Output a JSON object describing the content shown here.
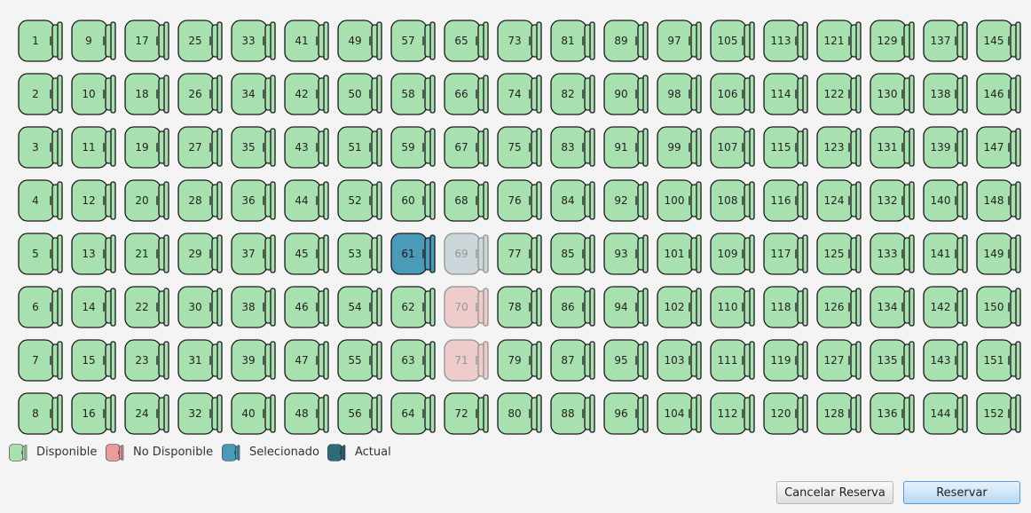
{
  "colors": {
    "available": "#a8e0b0",
    "unavailable": "#e89c9c",
    "selected": "#4a9ab8",
    "current": "#2e6a78",
    "blocked": "#9bb4bc",
    "outline": "#1a1a1a"
  },
  "seat_map": {
    "columns": 19,
    "rows": 8,
    "seats": [
      {
        "number": "1",
        "status": "available"
      },
      {
        "number": "2",
        "status": "available"
      },
      {
        "number": "3",
        "status": "available"
      },
      {
        "number": "4",
        "status": "available"
      },
      {
        "number": "5",
        "status": "available"
      },
      {
        "number": "6",
        "status": "available"
      },
      {
        "number": "7",
        "status": "available"
      },
      {
        "number": "8",
        "status": "available"
      },
      {
        "number": "9",
        "status": "available"
      },
      {
        "number": "10",
        "status": "available"
      },
      {
        "number": "11",
        "status": "available"
      },
      {
        "number": "12",
        "status": "available"
      },
      {
        "number": "13",
        "status": "available"
      },
      {
        "number": "14",
        "status": "available"
      },
      {
        "number": "15",
        "status": "available"
      },
      {
        "number": "16",
        "status": "available"
      },
      {
        "number": "17",
        "status": "available"
      },
      {
        "number": "18",
        "status": "available"
      },
      {
        "number": "19",
        "status": "available"
      },
      {
        "number": "20",
        "status": "available"
      },
      {
        "number": "21",
        "status": "available"
      },
      {
        "number": "22",
        "status": "available"
      },
      {
        "number": "23",
        "status": "available"
      },
      {
        "number": "24",
        "status": "available"
      },
      {
        "number": "25",
        "status": "available"
      },
      {
        "number": "26",
        "status": "available"
      },
      {
        "number": "27",
        "status": "available"
      },
      {
        "number": "28",
        "status": "available"
      },
      {
        "number": "29",
        "status": "available"
      },
      {
        "number": "30",
        "status": "available"
      },
      {
        "number": "31",
        "status": "available"
      },
      {
        "number": "32",
        "status": "available"
      },
      {
        "number": "33",
        "status": "available"
      },
      {
        "number": "34",
        "status": "available"
      },
      {
        "number": "35",
        "status": "available"
      },
      {
        "number": "36",
        "status": "available"
      },
      {
        "number": "37",
        "status": "available"
      },
      {
        "number": "38",
        "status": "available"
      },
      {
        "number": "39",
        "status": "available"
      },
      {
        "number": "40",
        "status": "available"
      },
      {
        "number": "41",
        "status": "available"
      },
      {
        "number": "42",
        "status": "available"
      },
      {
        "number": "43",
        "status": "available"
      },
      {
        "number": "44",
        "status": "available"
      },
      {
        "number": "45",
        "status": "available"
      },
      {
        "number": "46",
        "status": "available"
      },
      {
        "number": "47",
        "status": "available"
      },
      {
        "number": "48",
        "status": "available"
      },
      {
        "number": "49",
        "status": "available"
      },
      {
        "number": "50",
        "status": "available"
      },
      {
        "number": "51",
        "status": "available"
      },
      {
        "number": "52",
        "status": "available"
      },
      {
        "number": "53",
        "status": "available"
      },
      {
        "number": "54",
        "status": "available"
      },
      {
        "number": "55",
        "status": "available"
      },
      {
        "number": "56",
        "status": "available"
      },
      {
        "number": "57",
        "status": "available"
      },
      {
        "number": "58",
        "status": "available"
      },
      {
        "number": "59",
        "status": "available"
      },
      {
        "number": "60",
        "status": "available"
      },
      {
        "number": "61",
        "status": "selected"
      },
      {
        "number": "62",
        "status": "available"
      },
      {
        "number": "63",
        "status": "available"
      },
      {
        "number": "64",
        "status": "available"
      },
      {
        "number": "65",
        "status": "available"
      },
      {
        "number": "66",
        "status": "available"
      },
      {
        "number": "67",
        "status": "available"
      },
      {
        "number": "68",
        "status": "available"
      },
      {
        "number": "69",
        "status": "blocked"
      },
      {
        "number": "70",
        "status": "unavailable"
      },
      {
        "number": "71",
        "status": "unavailable"
      },
      {
        "number": "72",
        "status": "available"
      },
      {
        "number": "73",
        "status": "available"
      },
      {
        "number": "74",
        "status": "available"
      },
      {
        "number": "75",
        "status": "available"
      },
      {
        "number": "76",
        "status": "available"
      },
      {
        "number": "77",
        "status": "available"
      },
      {
        "number": "78",
        "status": "available"
      },
      {
        "number": "79",
        "status": "available"
      },
      {
        "number": "80",
        "status": "available"
      },
      {
        "number": "81",
        "status": "available"
      },
      {
        "number": "82",
        "status": "available"
      },
      {
        "number": "83",
        "status": "available"
      },
      {
        "number": "84",
        "status": "available"
      },
      {
        "number": "85",
        "status": "available"
      },
      {
        "number": "86",
        "status": "available"
      },
      {
        "number": "87",
        "status": "available"
      },
      {
        "number": "88",
        "status": "available"
      },
      {
        "number": "89",
        "status": "available"
      },
      {
        "number": "90",
        "status": "available"
      },
      {
        "number": "91",
        "status": "available"
      },
      {
        "number": "92",
        "status": "available"
      },
      {
        "number": "93",
        "status": "available"
      },
      {
        "number": "94",
        "status": "available"
      },
      {
        "number": "95",
        "status": "available"
      },
      {
        "number": "96",
        "status": "available"
      },
      {
        "number": "97",
        "status": "available"
      },
      {
        "number": "98",
        "status": "available"
      },
      {
        "number": "99",
        "status": "available"
      },
      {
        "number": "100",
        "status": "available"
      },
      {
        "number": "101",
        "status": "available"
      },
      {
        "number": "102",
        "status": "available"
      },
      {
        "number": "103",
        "status": "available"
      },
      {
        "number": "104",
        "status": "available"
      },
      {
        "number": "105",
        "status": "available"
      },
      {
        "number": "106",
        "status": "available"
      },
      {
        "number": "107",
        "status": "available"
      },
      {
        "number": "108",
        "status": "available"
      },
      {
        "number": "109",
        "status": "available"
      },
      {
        "number": "110",
        "status": "available"
      },
      {
        "number": "111",
        "status": "available"
      },
      {
        "number": "112",
        "status": "available"
      },
      {
        "number": "113",
        "status": "available"
      },
      {
        "number": "114",
        "status": "available"
      },
      {
        "number": "115",
        "status": "available"
      },
      {
        "number": "116",
        "status": "available"
      },
      {
        "number": "117",
        "status": "available"
      },
      {
        "number": "118",
        "status": "available"
      },
      {
        "number": "119",
        "status": "available"
      },
      {
        "number": "120",
        "status": "available"
      },
      {
        "number": "121",
        "status": "available"
      },
      {
        "number": "122",
        "status": "available"
      },
      {
        "number": "123",
        "status": "available"
      },
      {
        "number": "124",
        "status": "available"
      },
      {
        "number": "125",
        "status": "available"
      },
      {
        "number": "126",
        "status": "available"
      },
      {
        "number": "127",
        "status": "available"
      },
      {
        "number": "128",
        "status": "available"
      },
      {
        "number": "129",
        "status": "available"
      },
      {
        "number": "130",
        "status": "available"
      },
      {
        "number": "131",
        "status": "available"
      },
      {
        "number": "132",
        "status": "available"
      },
      {
        "number": "133",
        "status": "available"
      },
      {
        "number": "134",
        "status": "available"
      },
      {
        "number": "135",
        "status": "available"
      },
      {
        "number": "136",
        "status": "available"
      },
      {
        "number": "137",
        "status": "available"
      },
      {
        "number": "138",
        "status": "available"
      },
      {
        "number": "139",
        "status": "available"
      },
      {
        "number": "140",
        "status": "available"
      },
      {
        "number": "141",
        "status": "available"
      },
      {
        "number": "142",
        "status": "available"
      },
      {
        "number": "143",
        "status": "available"
      },
      {
        "number": "144",
        "status": "available"
      },
      {
        "number": "145",
        "status": "available"
      },
      {
        "number": "146",
        "status": "available"
      },
      {
        "number": "147",
        "status": "available"
      },
      {
        "number": "148",
        "status": "available"
      },
      {
        "number": "149",
        "status": "available"
      },
      {
        "number": "150",
        "status": "available"
      },
      {
        "number": "151",
        "status": "available"
      },
      {
        "number": "152",
        "status": "available"
      }
    ]
  },
  "legend": [
    {
      "label": "Disponible",
      "status": "available"
    },
    {
      "label": "No Disponible",
      "status": "unavailable"
    },
    {
      "label": "Selecionado",
      "status": "selected"
    },
    {
      "label": "Actual",
      "status": "current"
    }
  ],
  "actions": {
    "cancel_label": "Cancelar Reserva",
    "reserve_label": "Reservar"
  }
}
